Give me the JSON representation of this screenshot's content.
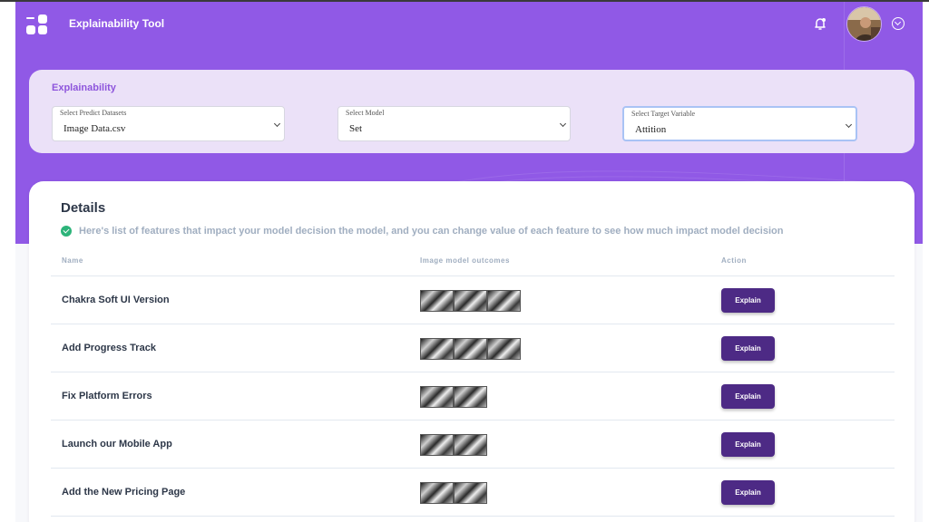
{
  "header": {
    "app_title": "Explainability Tool",
    "logo_icon": "app-logo-icon",
    "notification_icon": "bell-icon",
    "profile_menu_icon": "chevron-down-circle-icon"
  },
  "filters": {
    "title": "Explainability",
    "dataset": {
      "label": "Select Predict Datasets",
      "value": "Image Data.csv"
    },
    "model": {
      "label": "Select Model",
      "value": "Set"
    },
    "target": {
      "label": "Select Target Variable",
      "value": "Attition"
    }
  },
  "details": {
    "title": "Details",
    "info": "Here's list of features that impact your model decision the model, and you can change value of each feature to see how much impact model decision",
    "columns": {
      "name": "Name",
      "outcomes": "Image model outcomes",
      "action": "Action"
    },
    "rows": [
      {
        "name": "Chakra Soft UI Version",
        "image_count": 3,
        "action": "Explain"
      },
      {
        "name": "Add Progress Track",
        "image_count": 3,
        "action": "Explain"
      },
      {
        "name": "Fix Platform Errors",
        "image_count": 2,
        "action": "Explain"
      },
      {
        "name": "Launch our Mobile App",
        "image_count": 2,
        "action": "Explain"
      },
      {
        "name": "Add the New Pricing Page",
        "image_count": 2,
        "action": "Explain"
      }
    ]
  },
  "colors": {
    "brand_purple": "#9059e6",
    "button_purple": "#4d2a85",
    "success_green": "#2db47a"
  }
}
